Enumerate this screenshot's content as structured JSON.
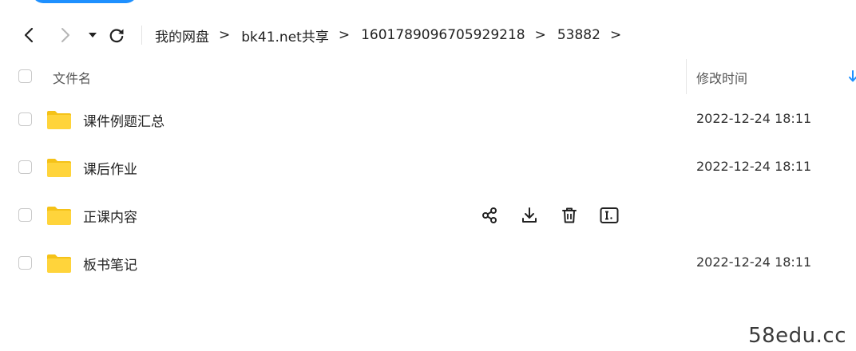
{
  "breadcrumb": {
    "items": [
      "我的网盘",
      "bk41.net共享",
      "1601789096705929218",
      "53882"
    ],
    "separator": ">"
  },
  "header": {
    "name_label": "文件名",
    "date_label": "修改时间"
  },
  "rows": [
    {
      "name": "课件例题汇总",
      "date": "2022-12-24 18:11"
    },
    {
      "name": "课后作业",
      "date": "2022-12-24 18:11"
    },
    {
      "name": "正课内容",
      "date": ""
    },
    {
      "name": "板书笔记",
      "date": "2022-12-24 18:11"
    }
  ],
  "colors": {
    "accent": "#1e90ff",
    "folder": "#ffd43b",
    "folder_tab": "#f5c218"
  },
  "icons": {
    "nav": [
      "chevron-left-icon",
      "chevron-right-icon",
      "caret-down-icon",
      "refresh-icon"
    ],
    "row_actions": [
      "share-icon",
      "download-icon",
      "delete-icon",
      "rename-icon"
    ],
    "sort": "sort-down-icon"
  },
  "watermark": "58edu.cc"
}
